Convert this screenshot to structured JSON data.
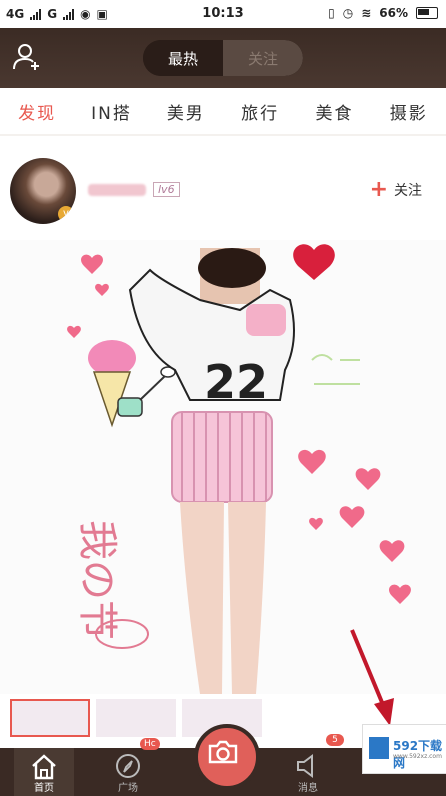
{
  "status": {
    "network1": "4G",
    "network2": "G",
    "time": "10:13",
    "battery": "66%"
  },
  "header": {
    "segment_hot": "最热",
    "segment_follow": "关注"
  },
  "categories": [
    {
      "label": "发现",
      "active": true
    },
    {
      "label": "IN搭"
    },
    {
      "label": "美男"
    },
    {
      "label": "旅行"
    },
    {
      "label": "美食"
    },
    {
      "label": "摄影"
    }
  ],
  "post": {
    "level": "lv6",
    "follow_label": "关注",
    "photo_text_jersey": "22",
    "photo_text_handwriting": "我の节"
  },
  "tabs": {
    "home": "首页",
    "plaza": "广场",
    "plaza_badge": "Hc",
    "messages": "消息",
    "messages_badge": "5"
  },
  "watermark": {
    "title": "592下载网",
    "subtitle": "www.592xz.com"
  },
  "colors": {
    "accent": "#e8584f",
    "topbar": "#3b2b24",
    "tabbar": "#3a2a24"
  }
}
